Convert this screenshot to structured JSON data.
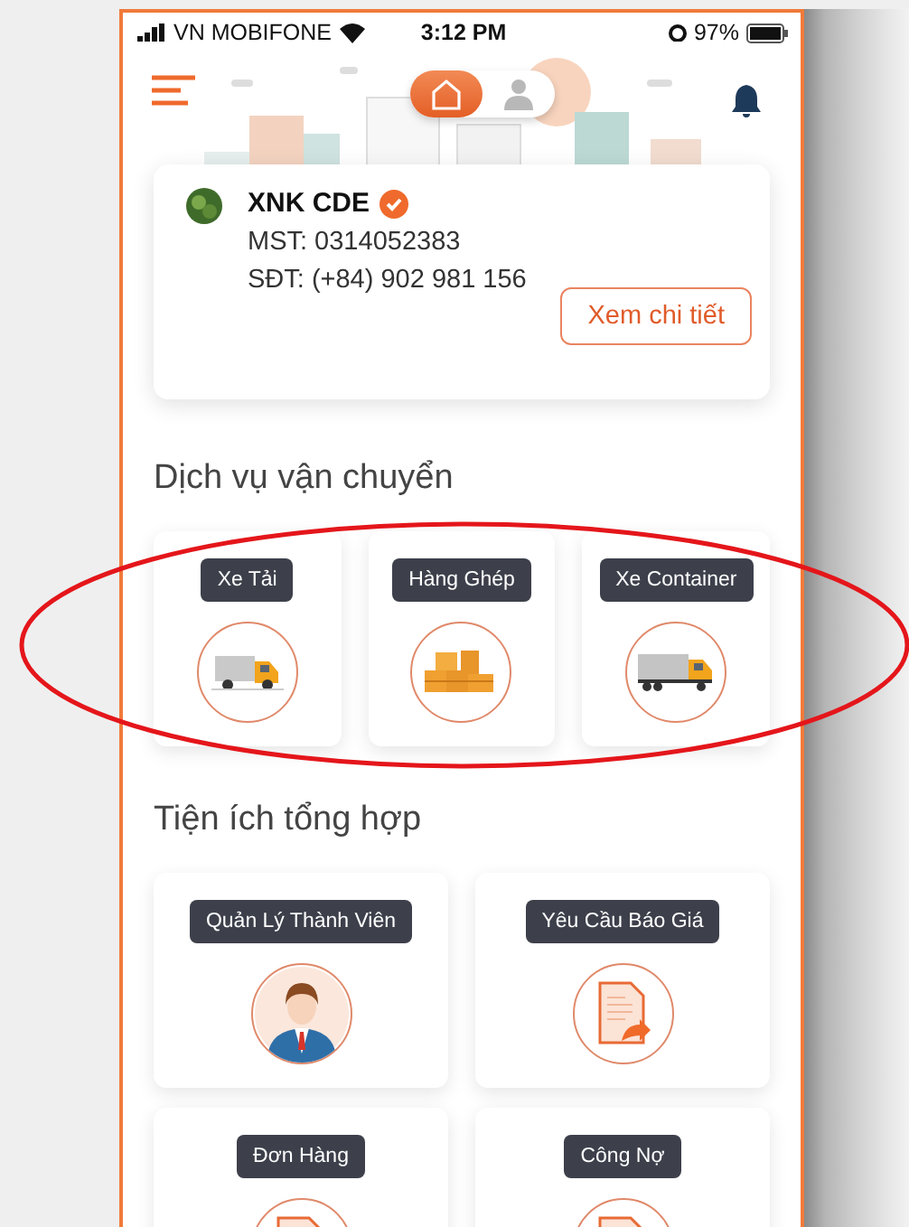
{
  "status_bar": {
    "carrier": "VN MOBIFONE",
    "time": "3:12 PM",
    "battery": "97%"
  },
  "header": {
    "tabs": [
      {
        "kind": "home",
        "selected": true
      },
      {
        "kind": "person",
        "selected": false
      }
    ]
  },
  "account": {
    "name": "XNK CDE",
    "verified": true,
    "tax_id": "MST: 0314052383",
    "phone": "SĐT: (+84) 902 981 156",
    "button": "Xem chi tiết"
  },
  "services": {
    "title": "Dịch vụ vận chuyển",
    "items": [
      {
        "label": "Xe Tải",
        "kind": "truck"
      },
      {
        "label": "Hàng Ghép",
        "kind": "boxes"
      },
      {
        "label": "Xe Container",
        "kind": "container"
      }
    ]
  },
  "utilities": {
    "title": "Tiện ích tổng hợp",
    "items": [
      {
        "label": "Quản Lý Thành Viên",
        "kind": "person"
      },
      {
        "label": "Yêu Cầu Báo Giá",
        "kind": "quote"
      },
      {
        "label": "Đơn Hàng",
        "kind": "document"
      },
      {
        "label": "Công Nợ",
        "kind": "document"
      }
    ]
  }
}
